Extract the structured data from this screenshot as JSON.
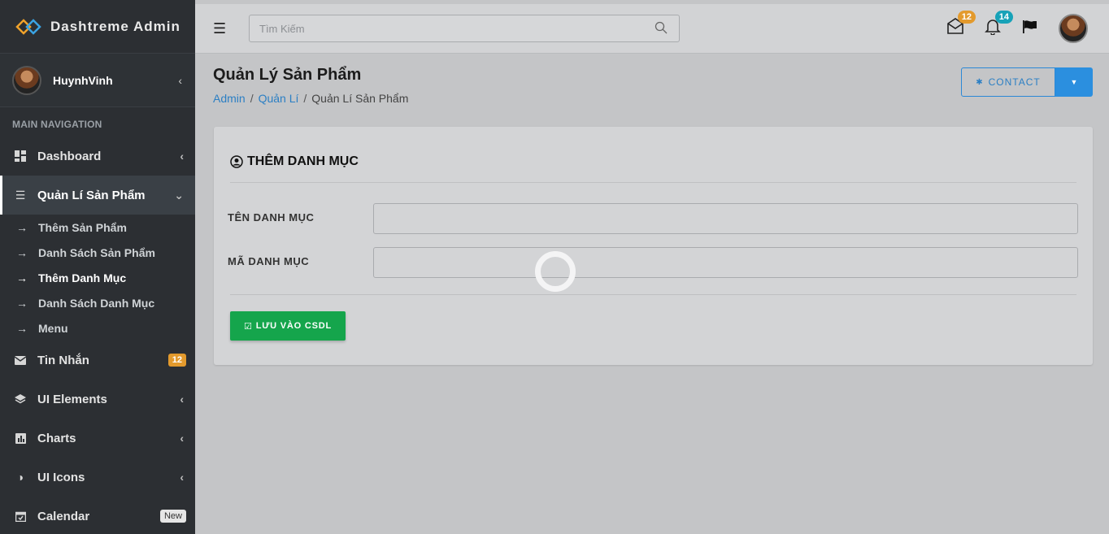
{
  "brand": {
    "title": "Dashtreme Admin"
  },
  "user": {
    "name": "HuynhVinh"
  },
  "sidebar": {
    "header": "MAIN NAVIGATION",
    "dashboard": "Dashboard",
    "products": "Quản Lí Sản Phẩm",
    "sub": [
      "Thêm Sản Phẩm",
      "Danh Sách Sản Phẩm",
      "Thêm Danh Mục",
      "Danh Sách Danh Mục",
      "Menu"
    ],
    "messages": "Tin Nhắn",
    "messages_badge": "12",
    "ui_elements": "UI Elements",
    "charts": "Charts",
    "ui_icons": "UI Icons",
    "calendar": "Calendar",
    "calendar_badge": "New"
  },
  "topbar": {
    "search_placeholder": "Tìm Kiếm",
    "mail_count": "12",
    "bell_count": "14"
  },
  "page": {
    "title": "Quản Lý Sản Phẩm",
    "breadcrumb": [
      "Admin",
      "Quản Lí",
      "Quản Lí Sản Phẩm"
    ],
    "contact_label": "CONTACT"
  },
  "form": {
    "title": "THÊM DANH MỤC",
    "name_label": "TÊN DANH MỤC",
    "code_label": "MÃ DANH MỤC",
    "save_label": "LƯU VÀO CSDL"
  },
  "colors": {
    "accent": "#2b8fdf",
    "success": "#15a54c",
    "badge_orange": "#e39a2d",
    "badge_teal": "#17a2b8"
  }
}
